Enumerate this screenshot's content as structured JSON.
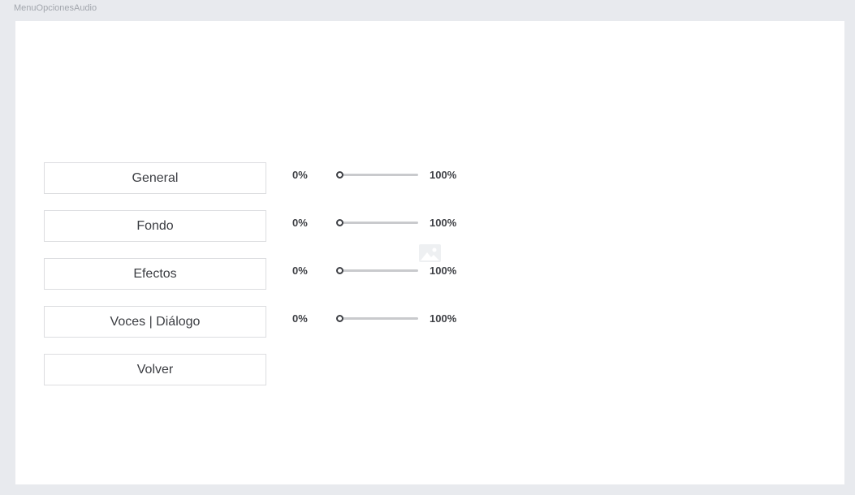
{
  "frame": {
    "title": "MenuOpcionesAudio"
  },
  "menu": {
    "buttons": [
      {
        "id": "general",
        "label": "General"
      },
      {
        "id": "fondo",
        "label": "Fondo"
      },
      {
        "id": "efectos",
        "label": "Efectos"
      },
      {
        "id": "voces",
        "label": "Voces | Diálogo"
      },
      {
        "id": "volver",
        "label": "Volver"
      }
    ]
  },
  "sliders": [
    {
      "name": "general",
      "min_label": "0%",
      "max_label": "100%",
      "value": 0
    },
    {
      "name": "fondo",
      "min_label": "0%",
      "max_label": "100%",
      "value": 0
    },
    {
      "name": "efectos",
      "min_label": "0%",
      "max_label": "100%",
      "value": 0
    },
    {
      "name": "voces",
      "min_label": "0%",
      "max_label": "100%",
      "value": 0
    }
  ],
  "icons": {
    "placeholder": "image-placeholder-icon"
  }
}
